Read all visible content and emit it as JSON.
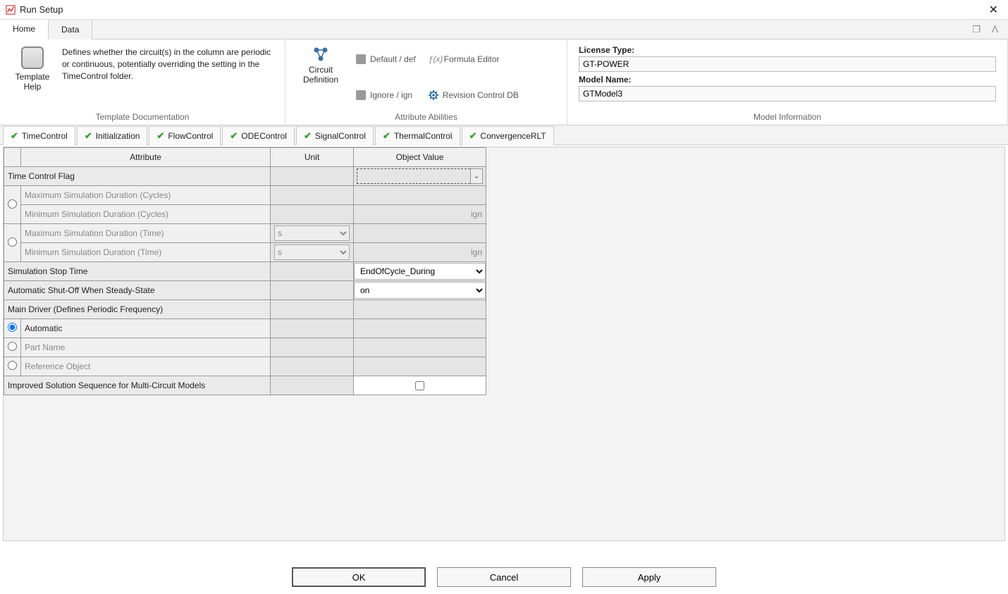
{
  "window": {
    "title": "Run Setup"
  },
  "mainTabs": {
    "home": "Home",
    "data": "Data"
  },
  "ribbon": {
    "templateHelp": "Template\nHelp",
    "description": "Defines whether the circuit(s) in the column are periodic or continuous, potentially overriding the setting in the TimeControl folder.",
    "templateDocFooter": "Template Documentation",
    "circuitDefinition": "Circuit\nDefinition",
    "attrAbilitiesFooter": "Attribute Abilities",
    "buttons": {
      "defaultDef": "Default / def",
      "ignoreIgn": "Ignore / ign",
      "formulaEditor": "Formula Editor",
      "revisionControl": "Revision Control DB"
    },
    "modelInfo": {
      "licenseTypeLabel": "License Type:",
      "licenseType": "GT-POWER",
      "modelNameLabel": "Model Name:",
      "modelName": "GTModel3",
      "footer": "Model Information"
    }
  },
  "subTabs": [
    "TimeControl",
    "Initialization",
    "FlowControl",
    "ODEControl",
    "SignalControl",
    "ThermalControl",
    "ConvergenceRLT"
  ],
  "table": {
    "headers": {
      "attribute": "Attribute",
      "unit": "Unit",
      "objectValue": "Object Value"
    },
    "rows": {
      "timeControlFlag": "Time Control Flag",
      "maxCycles": "Maximum Simulation Duration (Cycles)",
      "minCycles": "Minimum Simulation Duration (Cycles)",
      "maxTime": "Maximum Simulation Duration (Time)",
      "minTime": "Minimum Simulation Duration (Time)",
      "simStopTime": "Simulation Stop Time",
      "autoShutOff": "Automatic Shut-Off When Steady-State",
      "mainDriver": "Main Driver (Defines Periodic Frequency)",
      "automatic": "Automatic",
      "partName": "Part Name",
      "refObject": "Reference Object",
      "improvedSolution": "Improved Solution Sequence for Multi-Circuit Models"
    },
    "values": {
      "ign": "ign",
      "unitS": "s",
      "simStopTime": "EndOfCycle_During",
      "autoShutOff": "on"
    }
  },
  "footerButtons": {
    "ok": "OK",
    "cancel": "Cancel",
    "apply": "Apply"
  }
}
